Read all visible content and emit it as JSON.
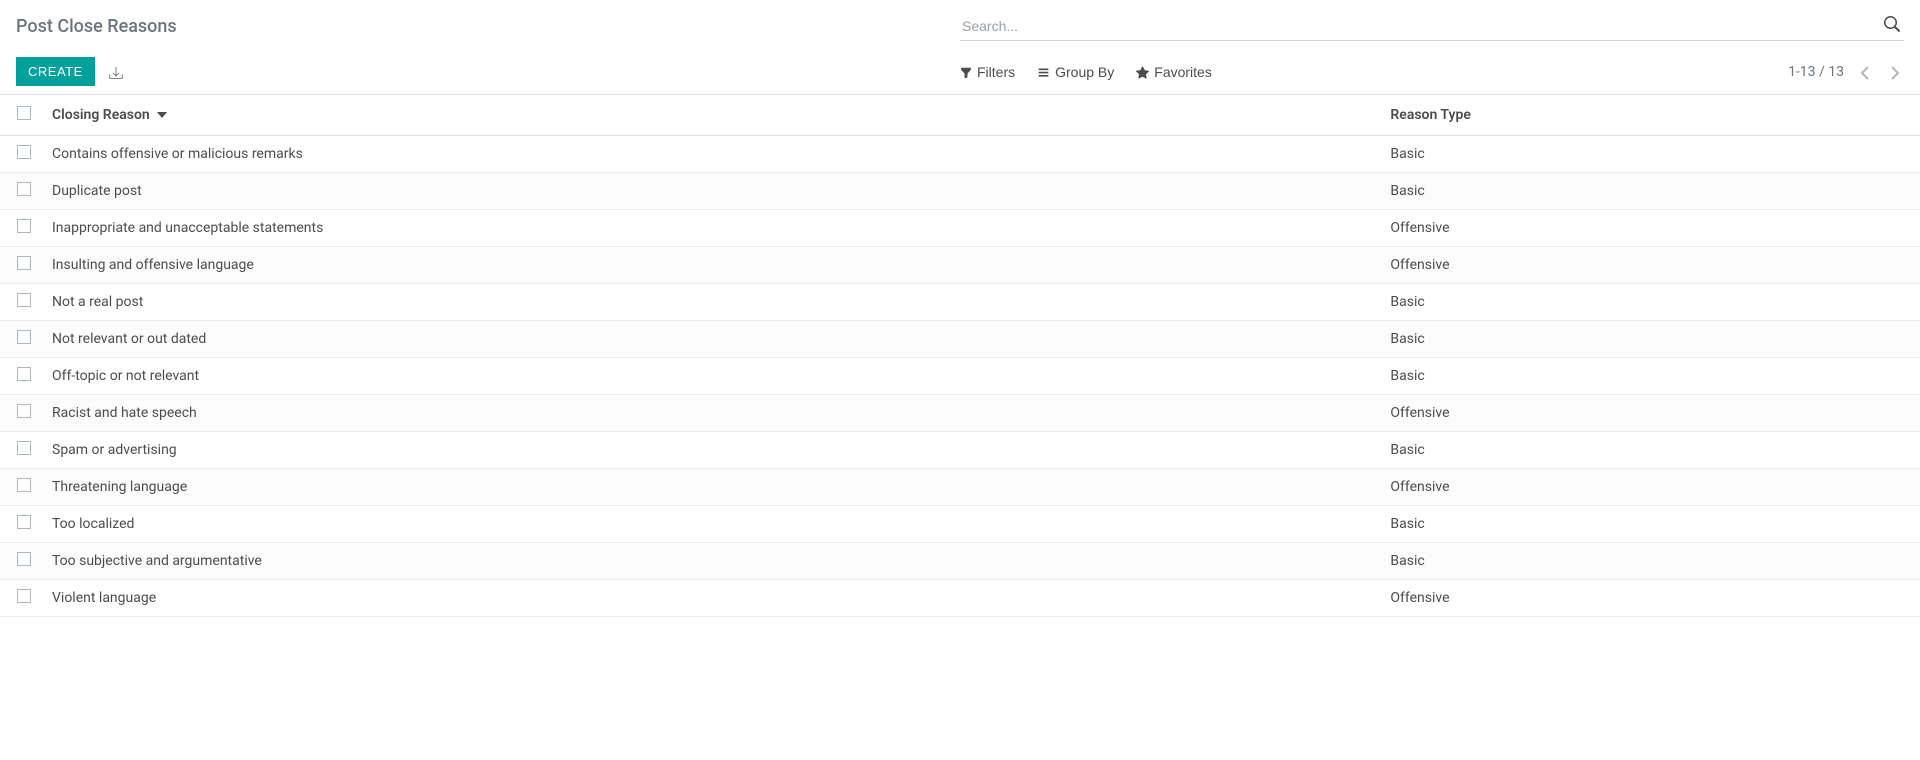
{
  "page_title": "Post Close Reasons",
  "search": {
    "placeholder": "Search..."
  },
  "toolbar": {
    "create_label": "Create",
    "filters_label": "Filters",
    "groupby_label": "Group By",
    "favorites_label": "Favorites"
  },
  "pager": {
    "range_text": "1-13 / 13"
  },
  "columns": {
    "closing_reason": "Closing Reason",
    "reason_type": "Reason Type"
  },
  "rows": [
    {
      "closing_reason": "Contains offensive or malicious remarks",
      "reason_type": "Basic"
    },
    {
      "closing_reason": "Duplicate post",
      "reason_type": "Basic"
    },
    {
      "closing_reason": "Inappropriate and unacceptable statements",
      "reason_type": "Offensive"
    },
    {
      "closing_reason": "Insulting and offensive language",
      "reason_type": "Offensive"
    },
    {
      "closing_reason": "Not a real post",
      "reason_type": "Basic"
    },
    {
      "closing_reason": "Not relevant or out dated",
      "reason_type": "Basic"
    },
    {
      "closing_reason": "Off-topic or not relevant",
      "reason_type": "Basic"
    },
    {
      "closing_reason": "Racist and hate speech",
      "reason_type": "Offensive"
    },
    {
      "closing_reason": "Spam or advertising",
      "reason_type": "Basic"
    },
    {
      "closing_reason": "Threatening language",
      "reason_type": "Offensive"
    },
    {
      "closing_reason": "Too localized",
      "reason_type": "Basic"
    },
    {
      "closing_reason": "Too subjective and argumentative",
      "reason_type": "Basic"
    },
    {
      "closing_reason": "Violent language",
      "reason_type": "Offensive"
    }
  ]
}
